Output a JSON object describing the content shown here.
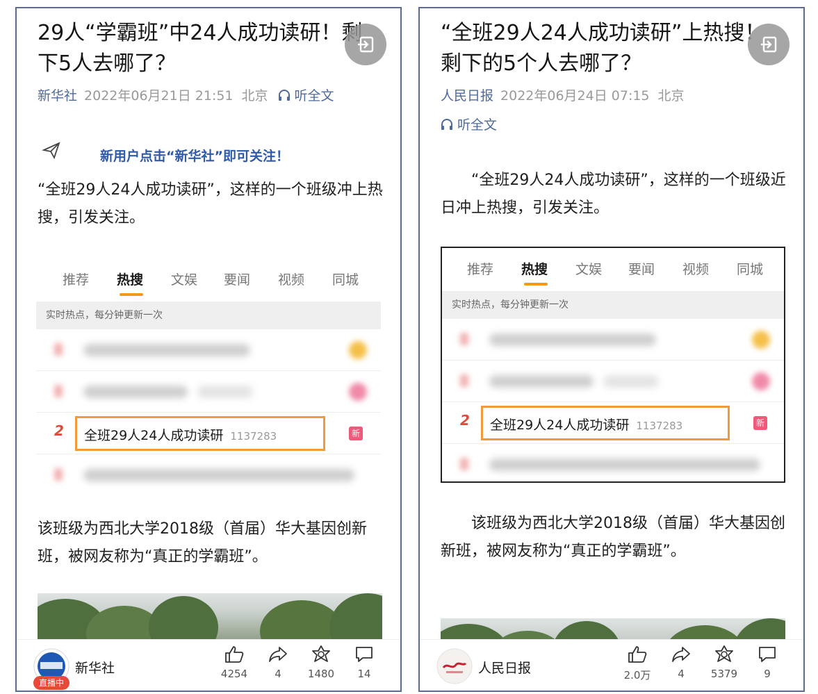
{
  "left": {
    "headline": "29人“学霸班”中24人成功读研！剩\n下5人去哪了？",
    "source": "新华社",
    "date": "2022年06月21日 21:51",
    "location": "北京",
    "listen_label": "听全文",
    "follow_text": "新用户点击“新华社”即可关注！",
    "para1": "“全班29人24人成功读研”，这样的一个班级冲上热搜，引发关注。",
    "para2": "该班级为西北大学2018级（首届）华大基因创新班，被网友称为“真正的学霸班”。",
    "shot": {
      "tabs": [
        "推荐",
        "热搜",
        "文娱",
        "要闻",
        "视频",
        "同城"
      ],
      "tip": "实时热点，每分钟更新一次",
      "rank": "2",
      "hot_title": "全班29人24人成功读研",
      "hot_count": "1137283",
      "badge": "新"
    },
    "footer": {
      "brand": "新华社",
      "live": "直播中",
      "likes": "4254",
      "shares": "4",
      "collect": "1480",
      "comments": "14"
    }
  },
  "right": {
    "headline": "“全班29人24人成功读研”上热搜！\n剩下的5个人去哪了？",
    "source": "人民日报",
    "date": "2022年06月24日 07:15",
    "location": "北京",
    "listen_label": "听全文",
    "para1": "“全班29人24人成功读研”，这样的一个班级近日冲上热搜，引发关注。",
    "para2": "该班级为西北大学2018级（首届）华大基因创新班，被网友称为“真正的学霸班”。",
    "shot": {
      "tabs": [
        "推荐",
        "热搜",
        "文娱",
        "要闻",
        "视频",
        "同城"
      ],
      "tip": "实时热点，每分钟更新一次",
      "rank": "2",
      "hot_title": "全班29人24人成功读研",
      "hot_count": "1137283",
      "badge": "新"
    },
    "footer": {
      "brand": "人民日报",
      "likes": "2.0万",
      "shares": "4",
      "collect": "5379",
      "comments": "9"
    }
  },
  "colors": {
    "accent_blue": "#4e6a9c",
    "highlight_orange": "#ef9b3d",
    "rank_red": "#e04b3c",
    "border": "#5b6b8f"
  }
}
